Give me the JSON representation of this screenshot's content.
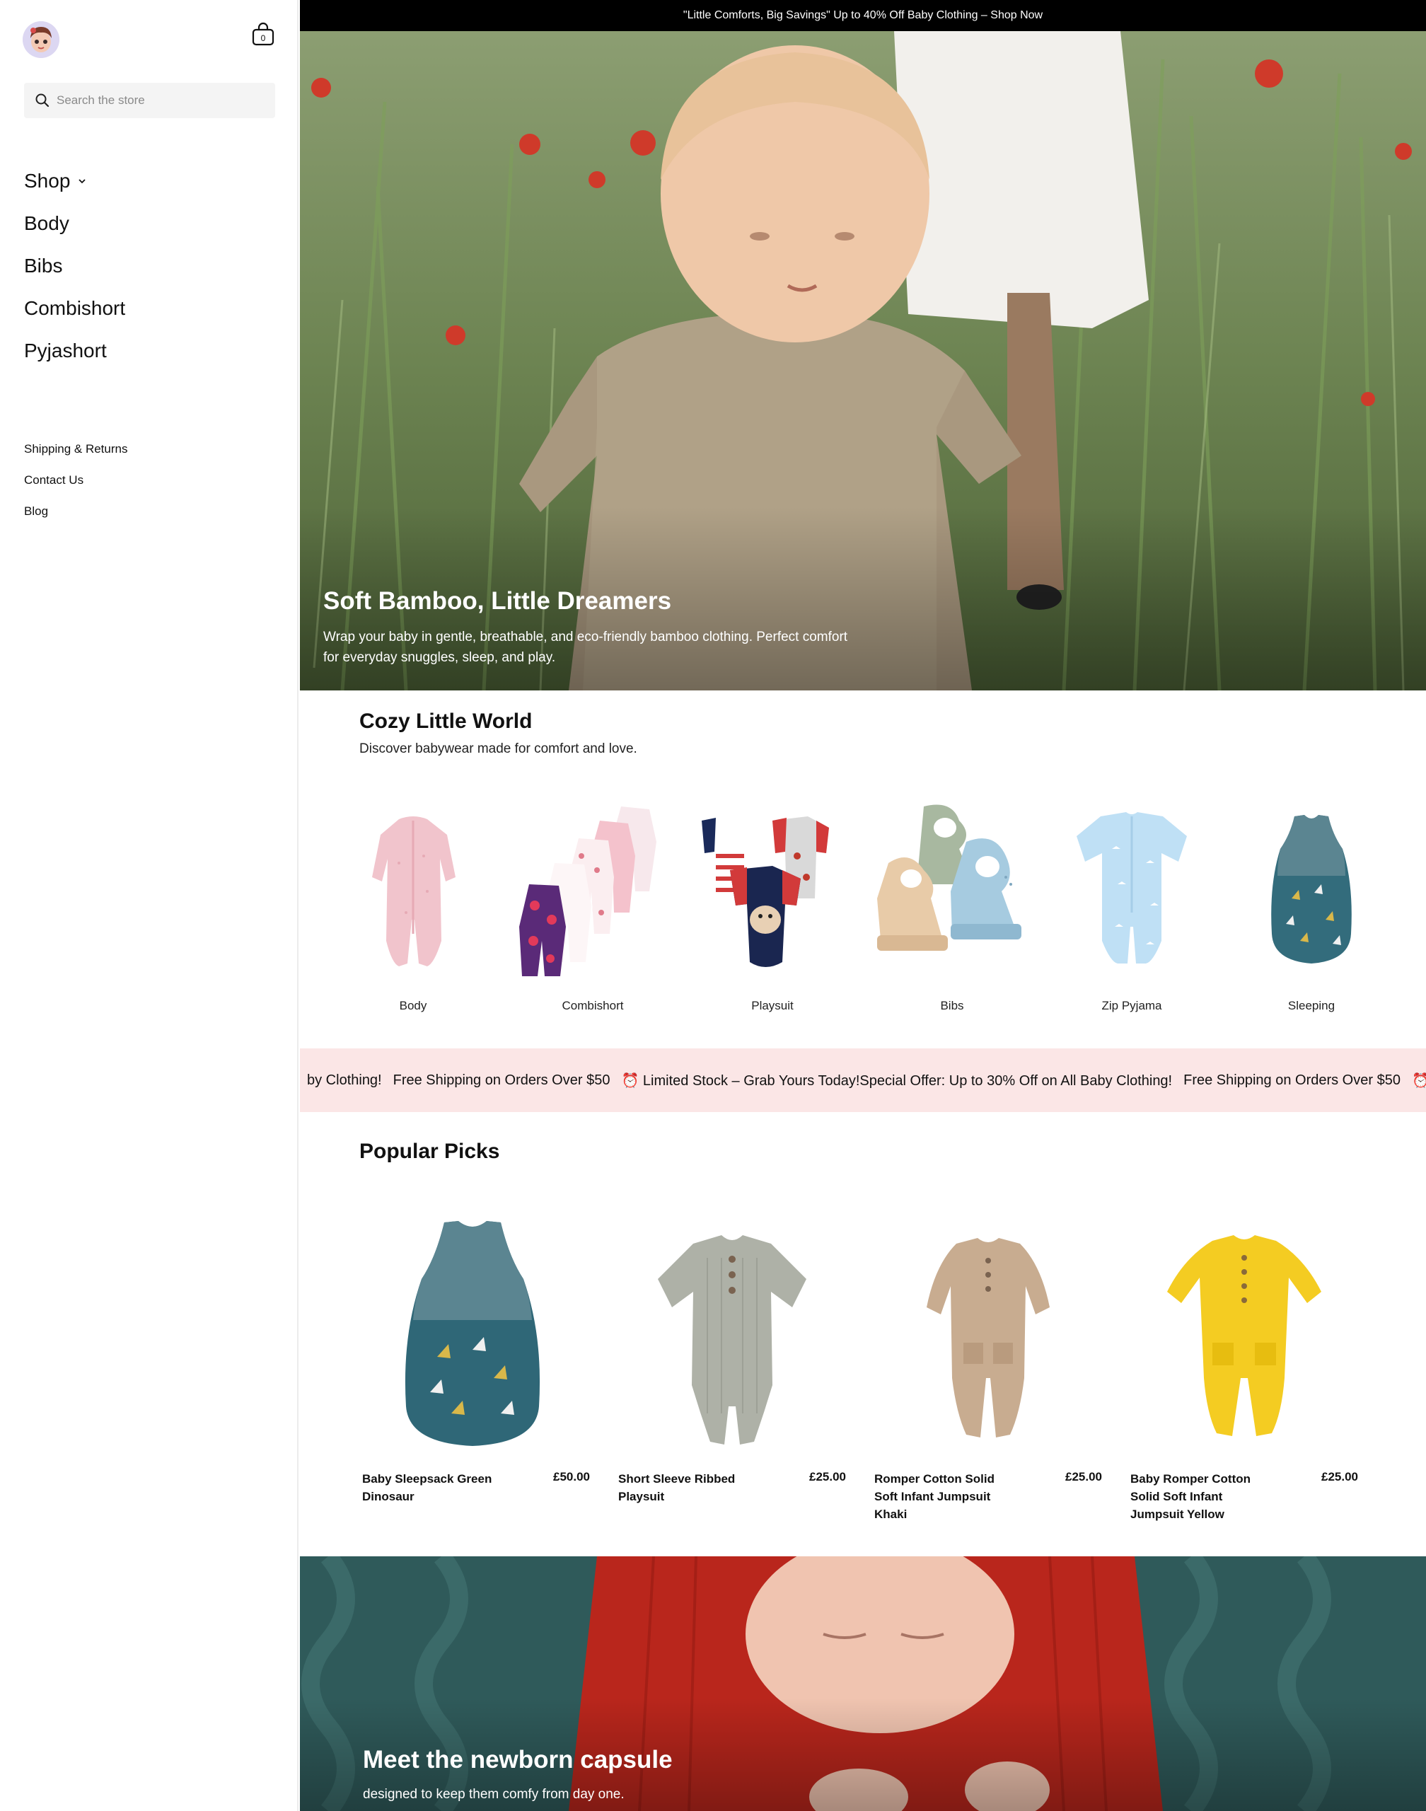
{
  "sidebar": {
    "logo_icon": "baby-avatar-logo",
    "cart_count": "0",
    "search_placeholder": "Search the store",
    "nav": [
      {
        "label": "Shop",
        "has_dropdown": true
      },
      {
        "label": "Body"
      },
      {
        "label": "Bibs"
      },
      {
        "label": "Combishort"
      },
      {
        "label": "Pyjashort"
      }
    ],
    "secondary": [
      {
        "label": "Shipping & Returns"
      },
      {
        "label": "Contact Us"
      },
      {
        "label": "Blog"
      }
    ]
  },
  "announcement": "\"Little Comforts, Big Savings\" Up to 40% Off Baby Clothing – Shop Now",
  "hero": {
    "title": "Soft Bamboo, Little Dreamers",
    "subtitle": "Wrap your baby in gentle, breathable, and eco-friendly bamboo clothing. Perfect comfort for everyday snuggles, sleep, and play."
  },
  "collections": {
    "title": "Cozy Little World",
    "subtitle": "Discover babywear made for comfort and love.",
    "items": [
      {
        "label": "Body"
      },
      {
        "label": "Combishort"
      },
      {
        "label": "Playsuit"
      },
      {
        "label": "Bibs"
      },
      {
        "label": "Zip Pyjama"
      },
      {
        "label": "Sleeping"
      }
    ]
  },
  "ticker": {
    "partial": "by Clothing!",
    "items": [
      "Free Shipping on Orders Over $50",
      "⏰ Limited Stock – Grab Yours Today!Special Offer: Up to 30% Off on All Baby Clothing!",
      "Free Shipping on Orders Over $50",
      "⏰"
    ]
  },
  "popular": {
    "title": "Popular Picks",
    "products": [
      {
        "name": "Baby Sleepsack Green Dinosaur",
        "price": "£50.00"
      },
      {
        "name": "Short Sleeve Ribbed Playsuit",
        "price": "£25.00"
      },
      {
        "name": "Romper Cotton Solid Soft Infant Jumpsuit Khaki",
        "price": "£25.00"
      },
      {
        "name": "Baby Romper Cotton Solid Soft Infant Jumpsuit Yellow",
        "price": "£25.00"
      }
    ]
  },
  "capsule": {
    "title": "Meet the newborn capsule",
    "subtitle": "designed to keep them comfy from day one."
  },
  "colors": {
    "announcement_bg": "#000000",
    "ticker_bg": "#fbe6e6",
    "sidebar_bg": "#ffffff",
    "search_bg": "#f4f4f4"
  }
}
